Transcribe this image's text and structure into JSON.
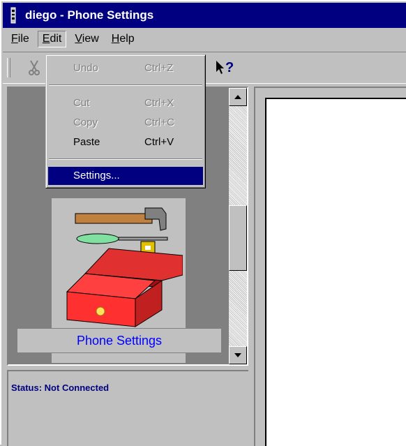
{
  "window": {
    "title": "diego - Phone Settings"
  },
  "menubar": {
    "items": [
      "File",
      "Edit",
      "View",
      "Help"
    ]
  },
  "edit_menu": {
    "items": [
      {
        "label": "Undo",
        "accel": "Ctrl+Z",
        "enabled": false
      },
      {
        "label": "Cut",
        "accel": "Ctrl+X",
        "enabled": false
      },
      {
        "label": "Copy",
        "accel": "Ctrl+C",
        "enabled": false
      },
      {
        "label": "Paste",
        "accel": "Ctrl+V",
        "enabled": true
      },
      {
        "label": "Settings...",
        "accel": "",
        "enabled": true,
        "selected": true
      }
    ]
  },
  "toolbar": {
    "icons": [
      "scissors-icon",
      "help-pointer-icon"
    ]
  },
  "left_pane": {
    "tile_label": "Phone Settings",
    "tile_icon": "toolbox-icon"
  },
  "status": {
    "text": "Status: Not Connected"
  },
  "colors": {
    "titlebar": "#000080",
    "selection": "#000080",
    "link": "#0000ff",
    "face": "#c0c0c0"
  }
}
